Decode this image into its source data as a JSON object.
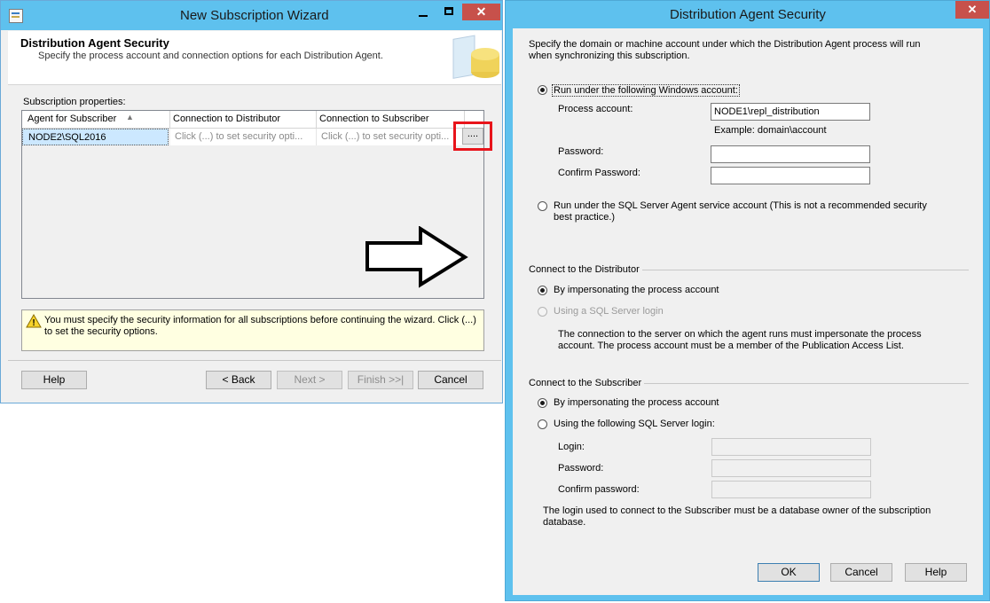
{
  "wizard": {
    "title": "New Subscription Wizard",
    "header_title": "Distribution Agent Security",
    "header_subtitle": "Specify the process account and connection options for each Distribution Agent.",
    "subscription_properties_label": "Subscription properties:",
    "grid": {
      "columns": [
        "Agent for Subscriber",
        "Connection to Distributor",
        "Connection to Subscriber"
      ],
      "rows": [
        {
          "agent": "NODE2\\SQL2016",
          "distributor": "Click (...) to set security opti...",
          "subscriber": "Click (...) to set security opti..."
        }
      ],
      "ellipsis_button": "...."
    },
    "warning_text": "You must specify the security information for all subscriptions before continuing the wizard. Click (...) to set the security options.",
    "buttons": {
      "help": "Help",
      "back": "< Back",
      "next": "Next >",
      "finish": "Finish >>|",
      "cancel": "Cancel"
    }
  },
  "dialog": {
    "title": "Distribution Agent Security",
    "intro": "Specify the domain or machine account under which the Distribution Agent process will run when synchronizing this subscription.",
    "run_windows_account": "Run under the following Windows account:",
    "process_account_label": "Process account:",
    "process_account_value": "NODE1\\repl_distribution",
    "example_text": "Example: domain\\account",
    "password_label": "Password:",
    "confirm_password_label": "Confirm Password:",
    "run_agent_service": "Run under the SQL Server Agent service account (This is not a recommended security best practice.)",
    "connect_distributor_heading": "Connect to the Distributor",
    "dist_impersonate": "By impersonating the process account",
    "dist_sql_login": "Using a SQL Server login",
    "dist_note": "The connection to the server on which the agent runs must impersonate the process account. The process account must be a member of the Publication Access List.",
    "connect_subscriber_heading": "Connect to the Subscriber",
    "sub_impersonate": "By impersonating the process account",
    "sub_sql_login": "Using the following SQL Server login:",
    "login_label": "Login:",
    "sub_password_label": "Password:",
    "sub_confirm_label": "Confirm password:",
    "sub_note": "The login used to connect to the Subscriber must be a database owner of the subscription database.",
    "buttons": {
      "ok": "OK",
      "cancel": "Cancel",
      "help": "Help"
    }
  }
}
